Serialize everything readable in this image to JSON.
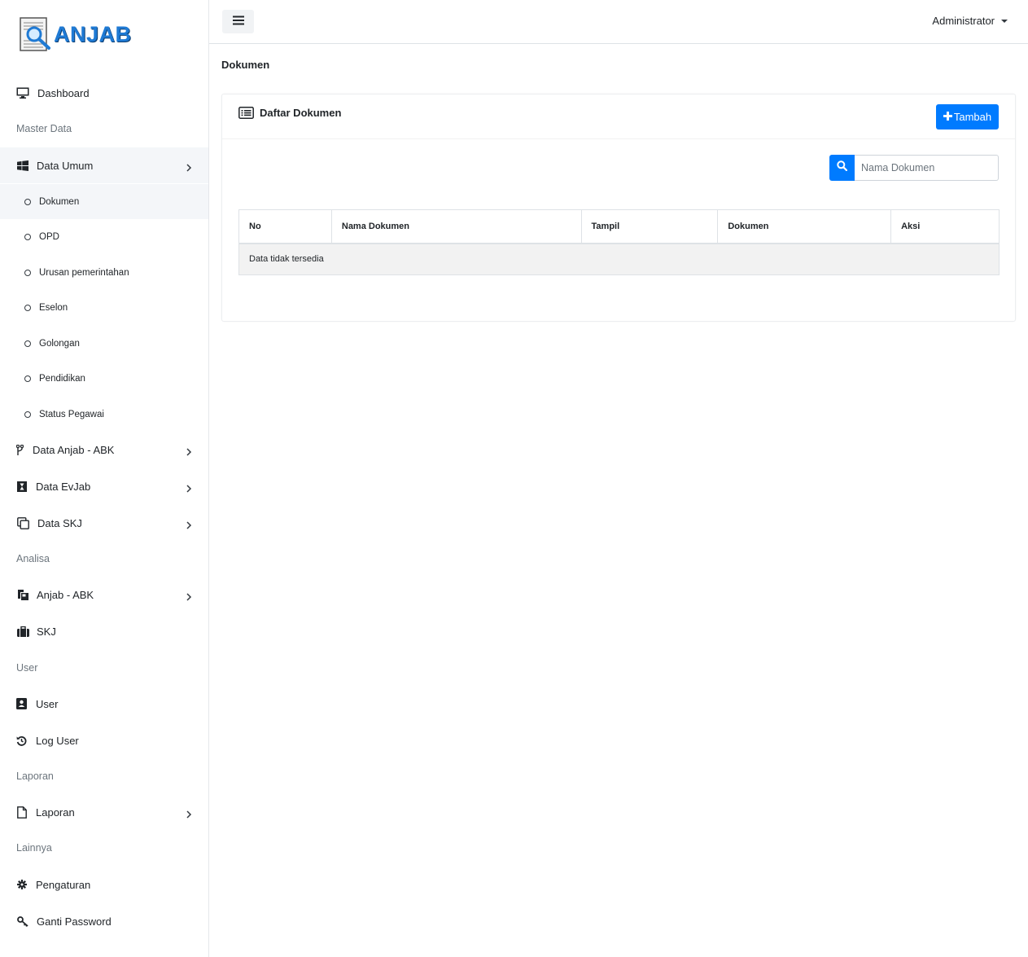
{
  "brand": {
    "name": "ANJAB"
  },
  "topbar": {
    "user": "Administrator"
  },
  "sidebar": {
    "dashboard": "Dashboard",
    "header_master": "Master Data",
    "data_umum": "Data Umum",
    "sub_items": [
      "Dokumen",
      "OPD",
      "Urusan pemerintahan",
      "Eselon",
      "Golongan",
      "Pendidikan",
      "Status Pegawai"
    ],
    "data_anjab": "Data Anjab - ABK",
    "data_evjab": "Data EvJab",
    "data_skj": "Data SKJ",
    "header_analisa": "Analisa",
    "anjab_abk": "Anjab - ABK",
    "skj": "SKJ",
    "header_user": "User",
    "user": "User",
    "log_user": "Log User",
    "header_laporan": "Laporan",
    "laporan": "Laporan",
    "header_lainnya": "Lainnya",
    "pengaturan": "Pengaturan",
    "ganti_password": "Ganti Password"
  },
  "page": {
    "title": "Dokumen",
    "card_title": "Daftar Dokumen",
    "add_button": "Tambah",
    "search_placeholder": "Nama Dokumen",
    "table": {
      "headers": [
        "No",
        "Nama Dokumen",
        "Tampil",
        "Dokumen",
        "Aksi"
      ],
      "empty": "Data tidak tersedia"
    }
  },
  "colors": {
    "accent": "#007bff",
    "brand": "#1f7ad4"
  }
}
